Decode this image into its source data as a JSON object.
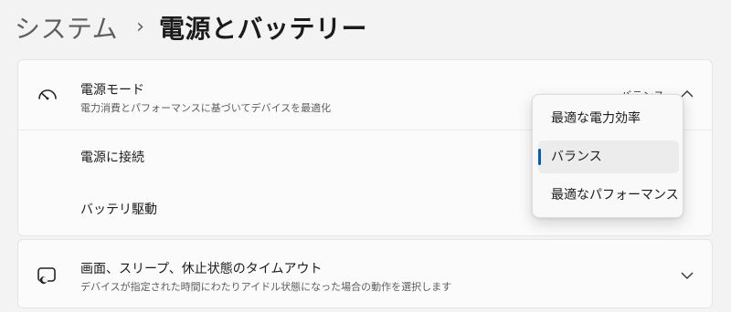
{
  "breadcrumb": {
    "parent": "システム",
    "separator": "›",
    "current": "電源とバッテリー"
  },
  "power_mode": {
    "title": "電源モード",
    "description": "電力消費とパフォーマンスに基づいてデバイスを最適化",
    "current_value": "バランス",
    "icon": "gauge-icon",
    "sub_rows": [
      "電源に接続",
      "バッテリ駆動"
    ]
  },
  "flyout": {
    "options": [
      "最適な電力効率",
      "バランス",
      "最適なパフォーマンス"
    ],
    "selected": "バランス",
    "accent": "#005fb8"
  },
  "screen_sleep": {
    "title": "画面、スリープ、休止状態のタイムアウト",
    "description": "デバイスが指定された時間にわたりアイドル状態になった場合の動作を選択します",
    "icon": "screen-sleep-icon"
  }
}
